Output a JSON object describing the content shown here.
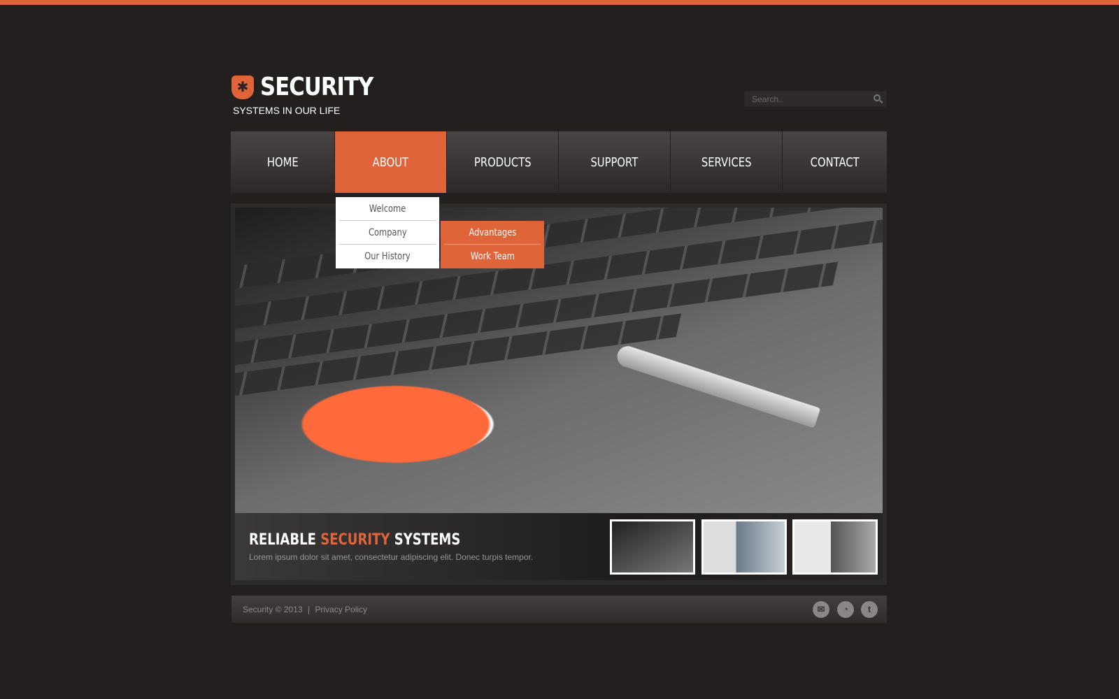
{
  "brand": {
    "title": "SECURITY",
    "subtitle": "SYSTEMS IN OUR LIFE",
    "accent": "#e0643a"
  },
  "search": {
    "placeholder": "Search.."
  },
  "nav": {
    "items": [
      {
        "label": "HOME"
      },
      {
        "label": "ABOUT",
        "active": true
      },
      {
        "label": "PRODUCTS"
      },
      {
        "label": "SUPPORT"
      },
      {
        "label": "SERVICES"
      },
      {
        "label": "CONTACT"
      }
    ]
  },
  "dropdown": {
    "items": [
      {
        "label": "Welcome"
      },
      {
        "label": "Company"
      },
      {
        "label": "Our History"
      }
    ]
  },
  "submenu": {
    "items": [
      {
        "label": "Advantages"
      },
      {
        "label": "Work Team"
      }
    ]
  },
  "slider": {
    "title_part1": "RELIABLE",
    "title_highlight": "SECURITY",
    "title_part2": "SYSTEMS",
    "text": "Lorem ipsum dolor sit amet, consectetur adipiscing elit. Donec turpis tempor."
  },
  "footer": {
    "copyright": "Security © 2013",
    "separator": "|",
    "privacy": "Privacy Policy",
    "social": [
      "mail-icon",
      "rss-icon",
      "twitter-icon"
    ]
  }
}
